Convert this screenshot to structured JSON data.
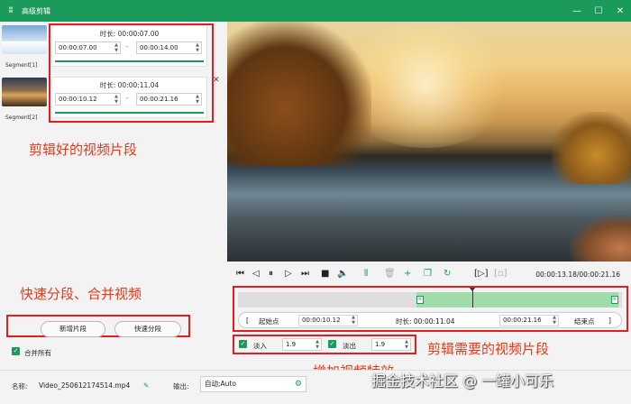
{
  "window": {
    "title": "高级剪辑",
    "minimize": "—",
    "maximize": "☐",
    "close": "✕"
  },
  "segments": [
    {
      "label": "Segment[1]",
      "duration": "时长: 00:00:07.00",
      "start": "00:00:07.00",
      "end": "00:00:14.00"
    },
    {
      "label": "Segment[2]",
      "duration": "时长: 00:00:11.04",
      "start": "00:00:10.12",
      "end": "00:00:21.16"
    }
  ],
  "annotations": {
    "edited_clips": "剪辑好的视频片段",
    "split_merge": "快速分段、合并视频",
    "needed_clip": "剪辑需要的视频片段",
    "add_effects": "增加视频特效"
  },
  "left_actions": {
    "new_segment": "新增片段",
    "quick_split": "快速分段",
    "merge_all": "合并所有"
  },
  "player": {
    "time": "00:00:13.18/00:00:21.16"
  },
  "range": {
    "start_label": "起始点",
    "start_value": "00:00:10.12",
    "duration_label": "时长: 00:00:11.04",
    "end_value": "00:00:21.16",
    "end_label": "结束点",
    "left_bracket": "[",
    "right_bracket": "]"
  },
  "effects": {
    "fade_in_label": "淡入",
    "fade_in_value": "1.9",
    "fade_out_label": "淡出",
    "fade_out_value": "1.9"
  },
  "bottom": {
    "name_label": "名称:",
    "filename": "Video_250612174514.mp4",
    "output_label": "输出:",
    "output_value": "自动;Auto"
  },
  "watermark": "掘金技术社区 @ 一罐小可乐",
  "colors": {
    "accent": "#1a9a5b",
    "annotation": "#e23b1c",
    "highlight_box": "#e02020"
  }
}
